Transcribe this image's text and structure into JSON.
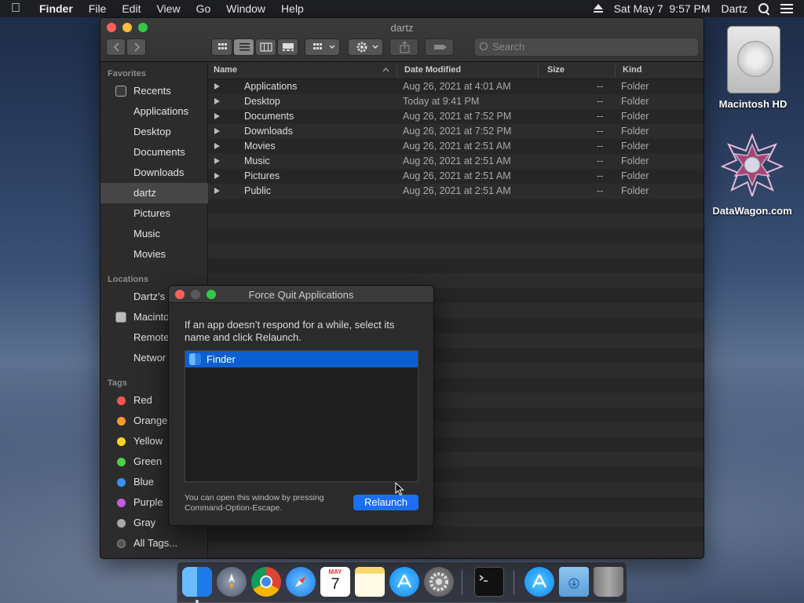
{
  "menubar": {
    "app_name": "Finder",
    "menus": [
      "File",
      "Edit",
      "View",
      "Go",
      "Window",
      "Help"
    ],
    "clock": "Sat May 7  9:57 PM",
    "user": "Dartz"
  },
  "finder": {
    "title": "dartz",
    "search_placeholder": "Search",
    "sidebar": {
      "favorites_header": "Favorites",
      "favorites": [
        "Recents",
        "Applications",
        "Desktop",
        "Documents",
        "Downloads",
        "dartz",
        "Pictures",
        "Music",
        "Movies"
      ],
      "selected_favorite": "dartz",
      "locations_header": "Locations",
      "locations": [
        "Dartz’s",
        "Macinto",
        "Remote",
        "Networ"
      ],
      "tags_header": "Tags",
      "tags": [
        {
          "label": "Red",
          "color": "#f4574f"
        },
        {
          "label": "Orange",
          "color": "#f59b2b"
        },
        {
          "label": "Yellow",
          "color": "#f6d22a"
        },
        {
          "label": "Green",
          "color": "#4fcd4c"
        },
        {
          "label": "Blue",
          "color": "#3a8ef5"
        },
        {
          "label": "Purple",
          "color": "#c25be0"
        },
        {
          "label": "Gray",
          "color": "#a9a9ab"
        },
        {
          "label": "All Tags...",
          "color": "#555555"
        }
      ]
    },
    "columns": {
      "name": "Name",
      "date_modified": "Date Modified",
      "size": "Size",
      "kind": "Kind"
    },
    "files": [
      {
        "name": "Applications",
        "date": "Aug 26, 2021 at 4:01 AM",
        "size": "--",
        "kind": "Folder"
      },
      {
        "name": "Desktop",
        "date": "Today at 9:41 PM",
        "size": "--",
        "kind": "Folder"
      },
      {
        "name": "Documents",
        "date": "Aug 26, 2021 at 7:52 PM",
        "size": "--",
        "kind": "Folder"
      },
      {
        "name": "Downloads",
        "date": "Aug 26, 2021 at 7:52 PM",
        "size": "--",
        "kind": "Folder"
      },
      {
        "name": "Movies",
        "date": "Aug 26, 2021 at 2:51 AM",
        "size": "--",
        "kind": "Folder"
      },
      {
        "name": "Music",
        "date": "Aug 26, 2021 at 2:51 AM",
        "size": "--",
        "kind": "Folder"
      },
      {
        "name": "Pictures",
        "date": "Aug 26, 2021 at 2:51 AM",
        "size": "--",
        "kind": "Folder"
      },
      {
        "name": "Public",
        "date": "Aug 26, 2021 at 2:51 AM",
        "size": "--",
        "kind": "Folder"
      }
    ]
  },
  "force_quit": {
    "title": "Force Quit Applications",
    "instruction": "If an app doesn’t respond for a while, select its name and click Relaunch.",
    "apps": [
      "Finder"
    ],
    "selected_app": "Finder",
    "hint_line1": "You can open this window by pressing",
    "hint_line2": "Command-Option-Escape.",
    "relaunch_label": "Relaunch"
  },
  "desktop": {
    "icons": [
      "Macintosh HD",
      "DataWagon.com"
    ]
  },
  "dock": {
    "apps": [
      "finder-icon",
      "launchpad-icon",
      "chrome-icon",
      "safari-icon",
      "calendar-icon",
      "notes-icon",
      "app-store-icon",
      "system-preferences-icon",
      "terminal-icon",
      "app-store-icon",
      "downloads-folder-icon",
      "trash-icon"
    ],
    "calendar_month": "MAY",
    "calendar_day": "7"
  }
}
